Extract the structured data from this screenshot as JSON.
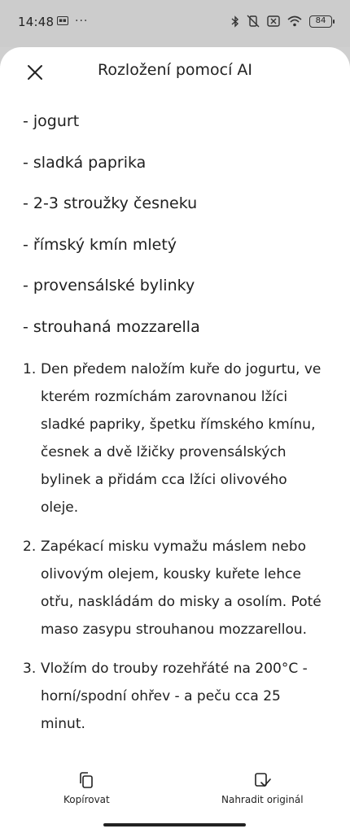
{
  "status_bar": {
    "time": "14:48",
    "overflow_dots": "···",
    "battery": "84"
  },
  "header": {
    "title": "Rozložení pomocí AI"
  },
  "ingredients": [
    "- jogurt",
    "- sladká paprika",
    "- 2-3 stroužky česneku",
    "- římský kmín mletý",
    "- provensálské bylinky",
    "- strouhaná mozzarella"
  ],
  "steps": [
    {
      "num": "1.",
      "text": "Den předem naložím kuře do jogurtu, ve kterém rozmíchám zarovnanou lžíci sladké papriky, špetku římského kmínu, česnek a dvě lžičky provensálských bylinek a přidám cca lžíci olivového oleje."
    },
    {
      "num": "2.",
      "text": "Zapékací misku vymažu máslem nebo olivovým olejem, kousky kuřete lehce otřu, naskládám do misky a osolím. Poté maso zasypu strouhanou mozzarellou."
    },
    {
      "num": "3.",
      "text": "Vložím do trouby rozehřáté na 200°C - horní/spodní ohřev - a peču cca 25 minut."
    }
  ],
  "actions": {
    "copy_label": "Kopírovat",
    "replace_label": "Nahradit originál"
  }
}
